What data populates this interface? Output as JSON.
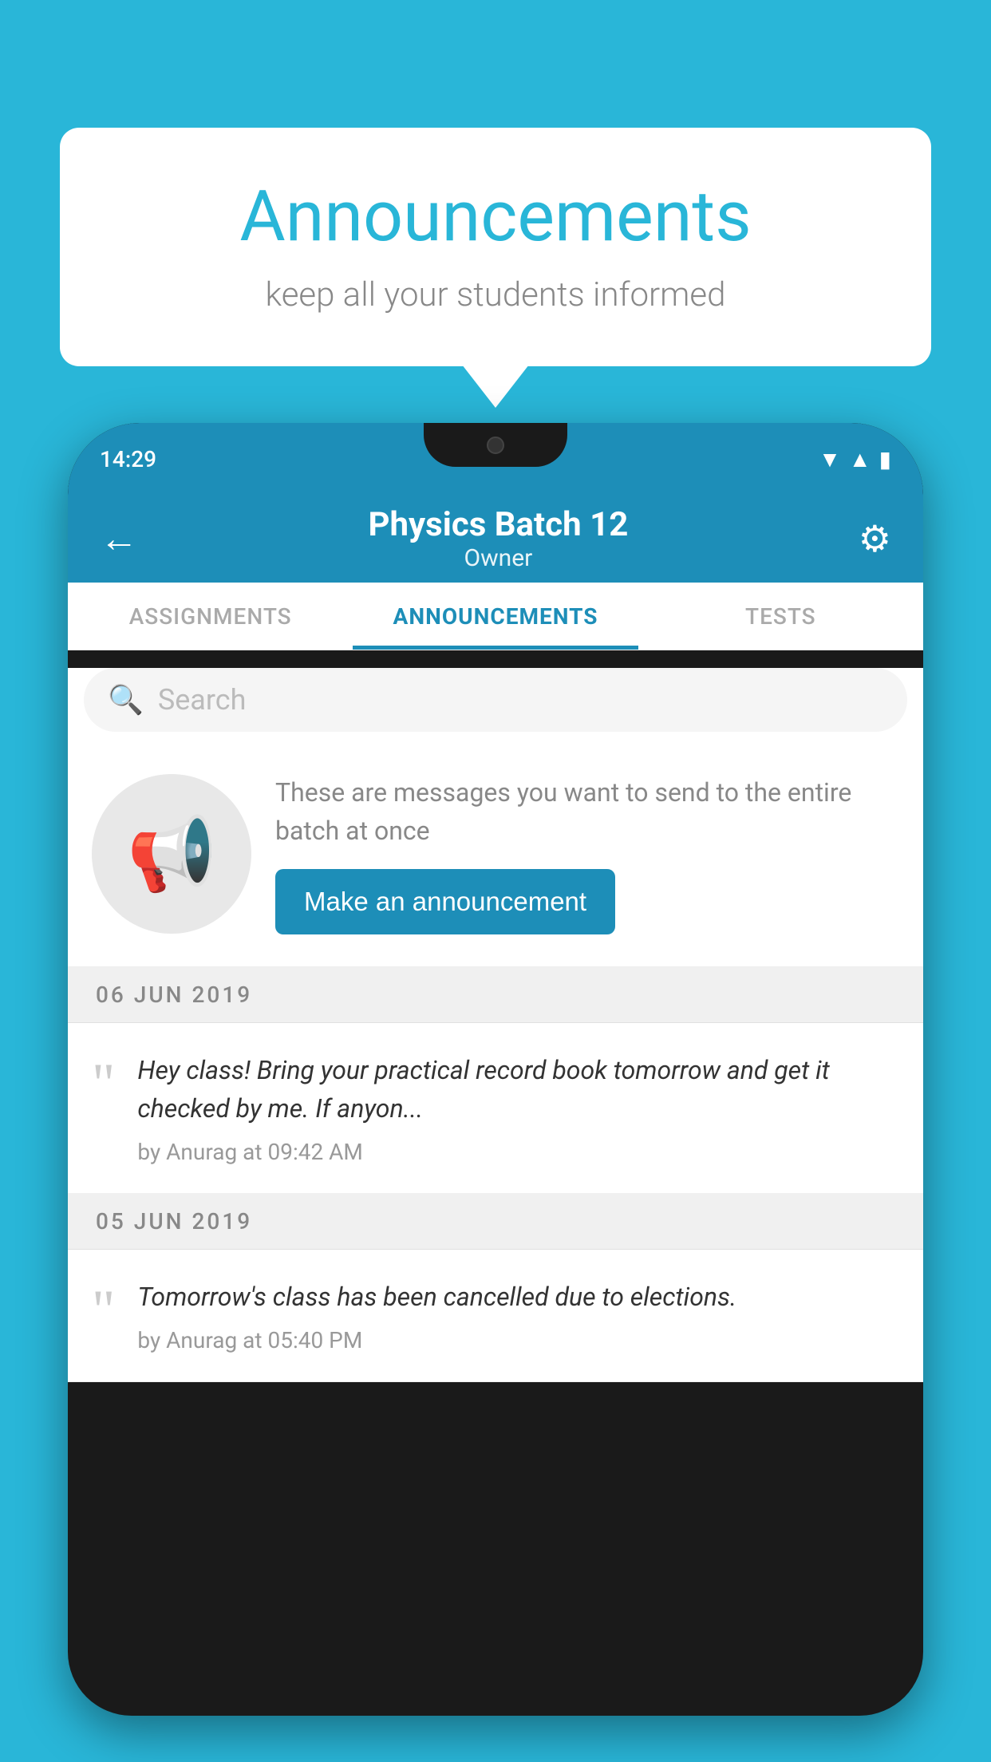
{
  "background_color": "#29b6d8",
  "speech_bubble": {
    "title": "Announcements",
    "subtitle": "keep all your students informed"
  },
  "phone": {
    "status_bar": {
      "time": "14:29",
      "icons": [
        "wifi",
        "signal",
        "battery"
      ]
    },
    "header": {
      "title": "Physics Batch 12",
      "subtitle": "Owner",
      "back_label": "←",
      "gear_label": "⚙"
    },
    "tabs": [
      {
        "label": "ASSIGNMENTS",
        "active": false
      },
      {
        "label": "ANNOUNCEMENTS",
        "active": true
      },
      {
        "label": "TESTS",
        "active": false
      }
    ],
    "search": {
      "placeholder": "Search"
    },
    "promo": {
      "description": "These are messages you want to send to the entire batch at once",
      "button_label": "Make an announcement"
    },
    "announcements": [
      {
        "date": "06  JUN  2019",
        "message": "Hey class! Bring your practical record book tomorrow and get it checked by me. If anyon...",
        "author": "by Anurag at 09:42 AM"
      },
      {
        "date": "05  JUN  2019",
        "message": "Tomorrow's class has been cancelled due to elections.",
        "author": "by Anurag at 05:40 PM"
      }
    ]
  }
}
